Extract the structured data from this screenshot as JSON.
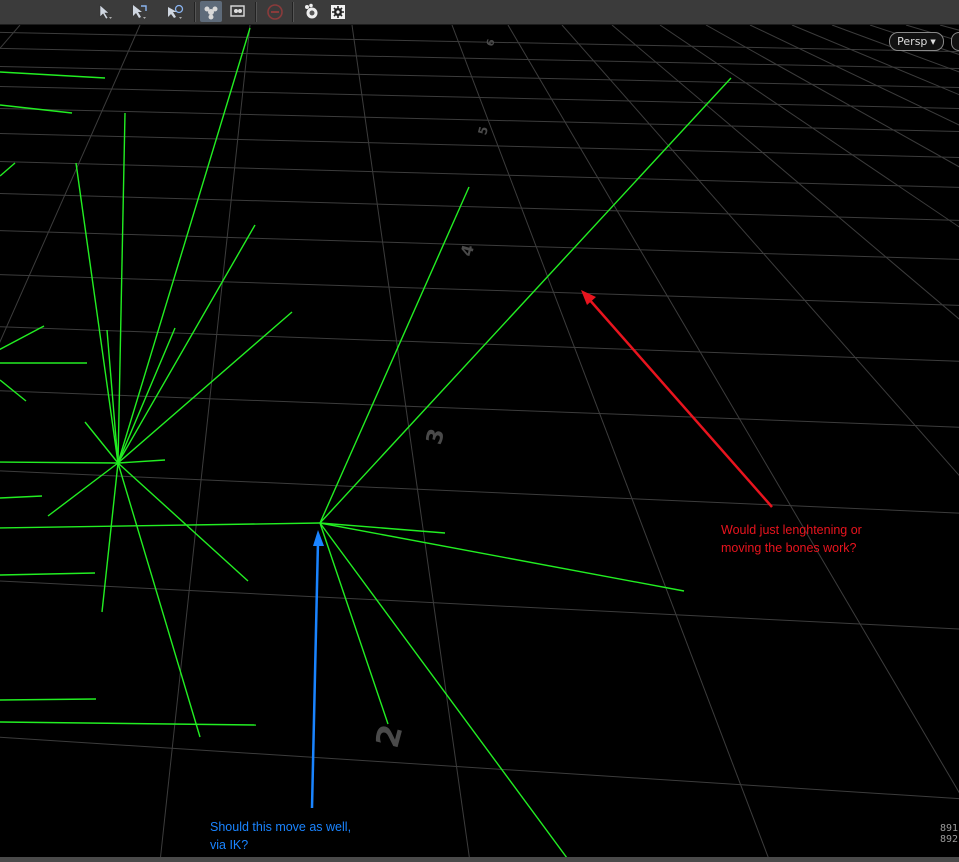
{
  "toolbar": {
    "buttons": [
      {
        "name": "select-tool-icon"
      },
      {
        "name": "move-tool-icon"
      },
      {
        "name": "rotate-tool-icon"
      },
      {
        "name": "bone-capture-icon"
      },
      {
        "name": "magnify-view-icon"
      },
      {
        "name": "disabled-no-icon"
      },
      {
        "name": "render-settings-icon"
      },
      {
        "name": "gear-icon"
      }
    ]
  },
  "viewport": {
    "camera_menu": "Persp",
    "grid_labels": [
      "2",
      "3",
      "4",
      "5",
      "6"
    ],
    "coordinates": [
      "891",
      "892"
    ]
  },
  "annotations": {
    "red": {
      "line1": "Would just lenghtening or",
      "line2": "moving the bones work?",
      "color": "#e8141e"
    },
    "blue": {
      "line1": "Should this move as well,",
      "line2": "via IK?",
      "color": "#1a84ff"
    }
  },
  "colors": {
    "bones": "#22ee22",
    "grid": "#3a3a3a",
    "background": "#000000"
  }
}
